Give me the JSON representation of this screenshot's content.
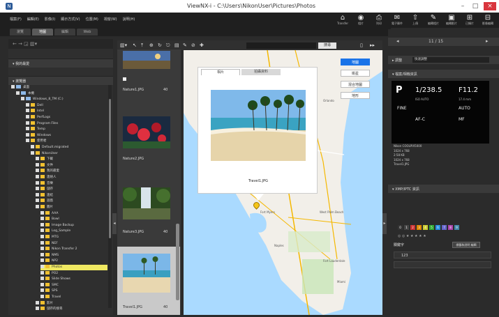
{
  "window": {
    "title": "ViewNX-i - C:\\Users\\NikonUser\\Pictures\\Photos",
    "logo_letter": "N",
    "minimize": "–",
    "maximize": "□",
    "close": "×"
  },
  "menu": [
    "檔案(F)",
    "編輯(E)",
    "影像(I)",
    "顯示方式(V)",
    "位置(M)",
    "視窗(W)",
    "說明(H)"
  ],
  "toolbar": [
    {
      "icon": "transfer-icon",
      "glyph": "⌂",
      "label": "Transfer"
    },
    {
      "icon": "share-icon",
      "glyph": "◉",
      "label": "相片"
    },
    {
      "icon": "print-icon",
      "glyph": "⎙",
      "label": "列印"
    },
    {
      "icon": "mail-icon",
      "glyph": "✉",
      "label": "電子郵件"
    },
    {
      "icon": "upload-icon",
      "glyph": "⇧",
      "label": "上傳"
    },
    {
      "icon": "edit-photo-icon",
      "glyph": "✎",
      "label": "編輯相片"
    },
    {
      "icon": "edit-video-icon",
      "glyph": "▣",
      "label": "編輯影片"
    },
    {
      "icon": "capture-icon",
      "glyph": "⊞",
      "label": "已擷片"
    },
    {
      "icon": "compose-icon",
      "glyph": "⊟",
      "label": "影像編輯"
    }
  ],
  "workspace_tabs": [
    "瀏覽",
    "地圖",
    "編輯",
    "Web"
  ],
  "left": {
    "nav_glyphs": "← →  ◲ ▥▾",
    "favorites_header": "▾ 我的最愛",
    "browser_header": "▾ 瀏覽器",
    "tree": [
      {
        "label": "桌面",
        "level": 0,
        "type": "drive"
      },
      {
        "label": "本機",
        "level": 1,
        "type": "drive"
      },
      {
        "label": "Windows_8_TM (C:)",
        "level": 2,
        "type": "drive"
      },
      {
        "label": "Dell",
        "level": 3,
        "type": "folder"
      },
      {
        "label": "Intel",
        "level": 3,
        "type": "folder"
      },
      {
        "label": "PerfLogs",
        "level": 3,
        "type": "folder"
      },
      {
        "label": "Program Files",
        "level": 3,
        "type": "folder"
      },
      {
        "label": "Temp",
        "level": 3,
        "type": "folder"
      },
      {
        "label": "Windows",
        "level": 3,
        "type": "folder"
      },
      {
        "label": "使用者",
        "level": 3,
        "type": "folder"
      },
      {
        "label": "Default.migrated",
        "level": 4,
        "type": "folder"
      },
      {
        "label": "NikonUser",
        "level": 4,
        "type": "folder"
      },
      {
        "label": "下載",
        "level": 5,
        "type": "folder"
      },
      {
        "label": "文件",
        "level": 5,
        "type": "folder"
      },
      {
        "label": "我的最愛",
        "level": 5,
        "type": "folder"
      },
      {
        "label": "連絡人",
        "level": 5,
        "type": "folder"
      },
      {
        "label": "音樂",
        "level": 5,
        "type": "folder"
      },
      {
        "label": "儲存",
        "level": 5,
        "type": "folder"
      },
      {
        "label": "連結",
        "level": 5,
        "type": "folder"
      },
      {
        "label": "遊戲",
        "level": 5,
        "type": "folder"
      },
      {
        "label": "圖片",
        "level": 5,
        "type": "folder"
      },
      {
        "label": "AAA",
        "level": 6,
        "type": "folder"
      },
      {
        "label": "Bowl",
        "level": 6,
        "type": "folder"
      },
      {
        "label": "Image Backup",
        "level": 6,
        "type": "folder"
      },
      {
        "label": "Log_Sample",
        "level": 6,
        "type": "folder"
      },
      {
        "label": "MTG",
        "level": 6,
        "type": "folder"
      },
      {
        "label": "NEF",
        "level": 6,
        "type": "folder"
      },
      {
        "label": "Nikon Transfer 2",
        "level": 6,
        "type": "folder"
      },
      {
        "label": "NMS",
        "level": 6,
        "type": "folder"
      },
      {
        "label": "NP2",
        "level": 6,
        "type": "folder"
      },
      {
        "label": "Photos",
        "level": 6,
        "type": "folder",
        "selected": true
      },
      {
        "label": "PO2",
        "level": 6,
        "type": "folder"
      },
      {
        "label": "Slide Shows",
        "level": 6,
        "type": "folder"
      },
      {
        "label": "SMC",
        "level": 6,
        "type": "folder"
      },
      {
        "label": "SPS",
        "level": 6,
        "type": "folder"
      },
      {
        "label": "Travel",
        "level": 6,
        "type": "folder"
      },
      {
        "label": "影片",
        "level": 5,
        "type": "folder"
      },
      {
        "label": "儲存的搜尋",
        "level": 5,
        "type": "folder"
      }
    ]
  },
  "thumbnails": [
    {
      "name": "Nature1.JPG",
      "num": "40"
    },
    {
      "name": "Nature2.JPG",
      "num": ""
    },
    {
      "name": "Nature3.JPG",
      "num": "40"
    },
    {
      "name": "Travel1.JPG",
      "num": "40"
    }
  ],
  "maptoolbar": {
    "glyphs": [
      "▥▾",
      "↖",
      "⤒",
      "⊕",
      "↻",
      "⎋",
      "▤",
      "✎",
      "⊘",
      "✚"
    ],
    "search_button": "搜尋"
  },
  "map": {
    "view_buttons": [
      "地圖",
      "衛星",
      "混合地圖",
      "地形"
    ],
    "active_view": "地圖",
    "popup_tabs": [
      "相片",
      "拍攝資料"
    ],
    "popup_caption": "Travel1.JPG",
    "cities": [
      "Orlando",
      "Tampa",
      "Fort Myers",
      "Naples",
      "Miami",
      "Fort Lauderdale",
      "West Palm Beach"
    ]
  },
  "right": {
    "counter": "11 / 15",
    "adjust_header": "▸ 調整",
    "adjust_select": "快速調整",
    "info_header": "▾ 檔案/相機資訊",
    "cam": {
      "mode": "P",
      "shutter": "1/238.5",
      "aperture": "F11.2",
      "iso": "ISO AUTO",
      "focal": "17.4 mm",
      "quality": "FINE",
      "wb": "AUTO",
      "af": "AF-C",
      "mf": "MF"
    },
    "cam_text": [
      "Nikon COOLPIX5000",
      "1024 x 768",
      "2:58 KB",
      "1024 x 768",
      "Travel1.JPG"
    ],
    "xmp_header": "▾ XMP/IPTC 資訊",
    "labels": [
      "0",
      "1",
      "2",
      "3",
      "4",
      "5",
      "6",
      "7",
      "8",
      "9"
    ],
    "rating_text": "◎ ◎ ★ ★ ★ ★ ★",
    "keyword_label": "關鍵字",
    "edit_button": "標籤和說明 編輯",
    "fields": [
      "123",
      ""
    ]
  },
  "colors": {
    "accent": "#1a73e8",
    "selection": "#efe861",
    "map_water": "#aadaff",
    "map_land": "#f2efe9"
  }
}
